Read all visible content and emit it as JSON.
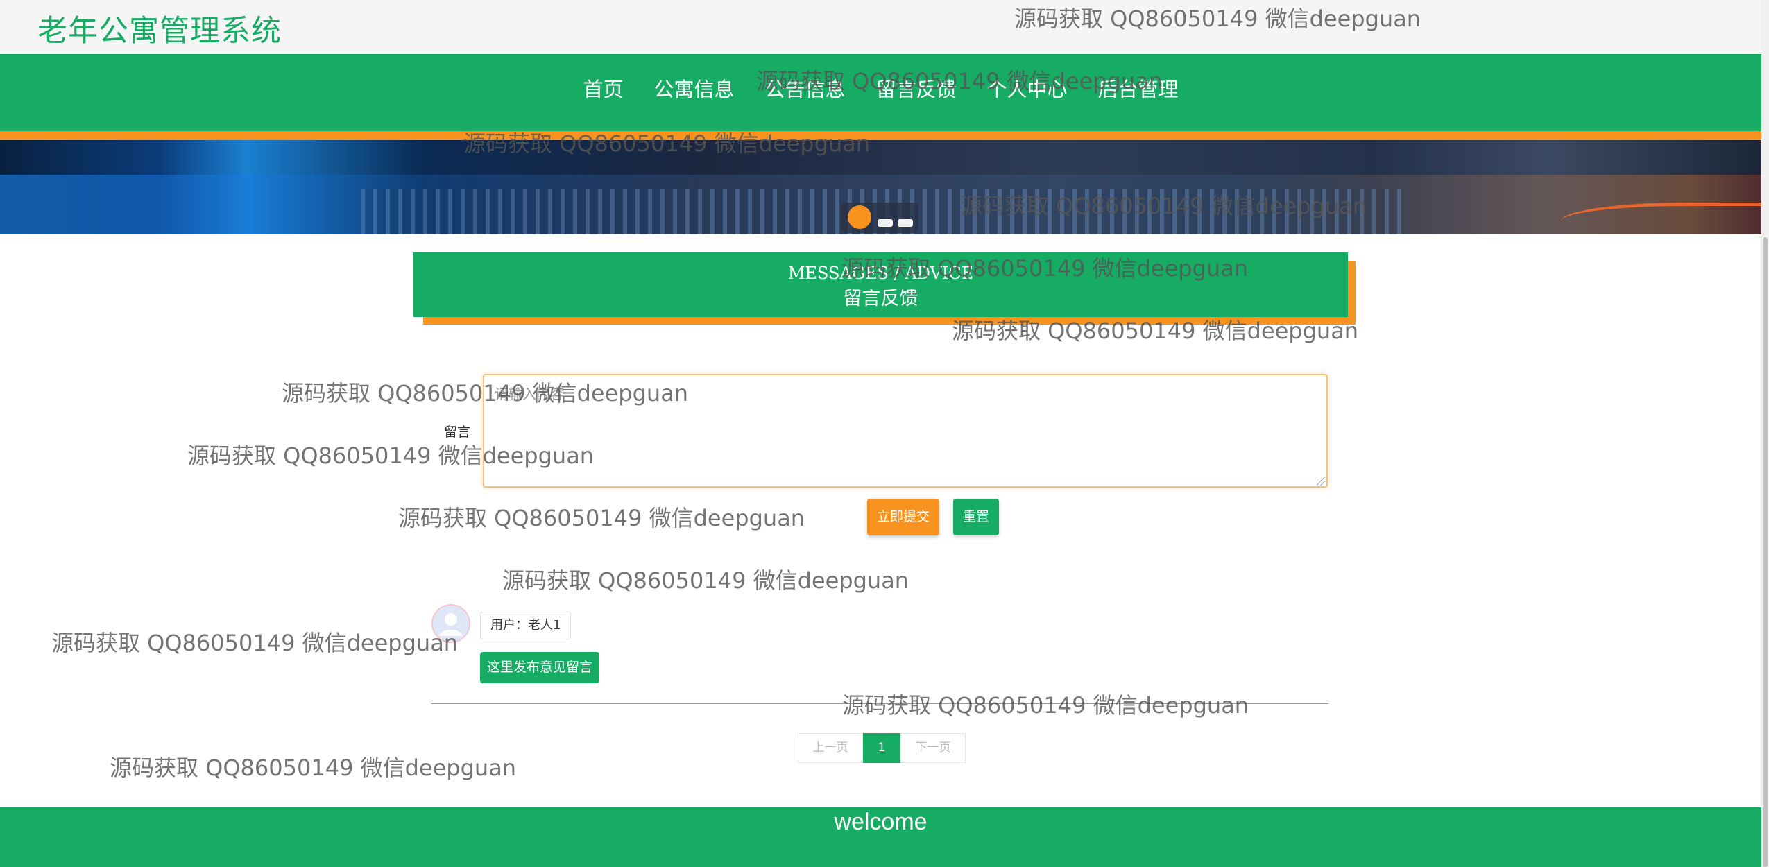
{
  "header": {
    "site_title": "老年公寓管理系统"
  },
  "nav": {
    "items": [
      {
        "label": "首页"
      },
      {
        "label": "公寓信息"
      },
      {
        "label": "公告信息"
      },
      {
        "label": "留言反馈"
      },
      {
        "label": "个人中心"
      },
      {
        "label": "后台管理"
      }
    ]
  },
  "banner": {
    "slide_count": 3,
    "active_slide": 1
  },
  "section": {
    "title_en": "MESSAGES / ADVICE",
    "title_cn": "留言反馈"
  },
  "form": {
    "label": "留言",
    "placeholder": "请输入内容",
    "submit_label": "立即提交",
    "reset_label": "重置"
  },
  "messages": [
    {
      "user": "用户：老人1",
      "content": "这里发布意见留言"
    }
  ],
  "pagination": {
    "prev": "上一页",
    "current": "1",
    "next": "下一页"
  },
  "footer": {
    "text": "welcome"
  },
  "watermark": {
    "text": "源码获取 QQ86050149 微信deepguan"
  },
  "colors": {
    "primary": "#17ac63",
    "accent": "#f7931e"
  }
}
